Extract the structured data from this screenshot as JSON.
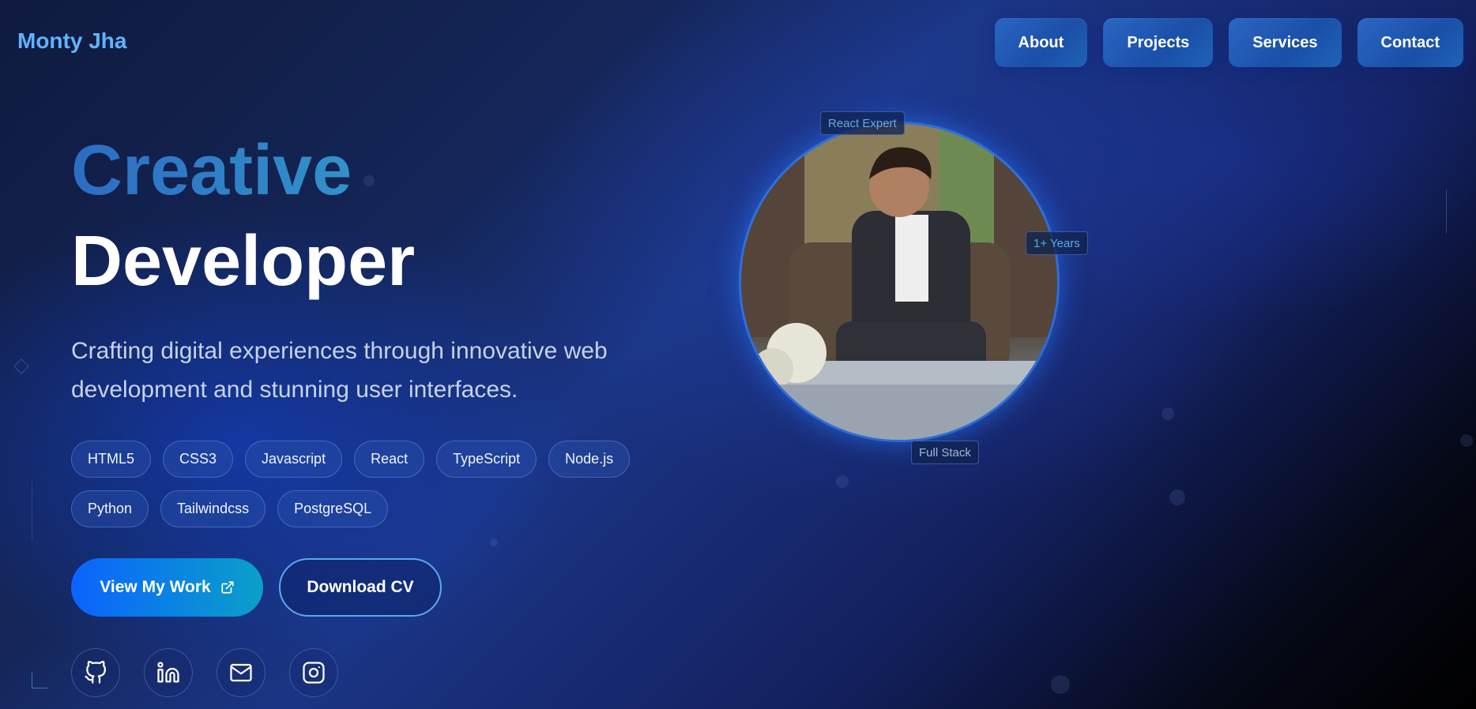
{
  "brand": "Monty Jha",
  "nav": [
    {
      "label": "About"
    },
    {
      "label": "Projects"
    },
    {
      "label": "Services"
    },
    {
      "label": "Contact"
    }
  ],
  "hero": {
    "line1": "Creative",
    "line2": "Developer",
    "subtitle": "Crafting digital experiences through innovative web development and stunning user interfaces."
  },
  "skills": [
    "HTML5",
    "CSS3",
    "Javascript",
    "React",
    "TypeScript",
    "Node.js",
    "Python",
    "Tailwindcss",
    "PostgreSQL"
  ],
  "buttons": {
    "view_work": "View My Work",
    "download_cv": "Download CV"
  },
  "socials": [
    {
      "name": "github-icon"
    },
    {
      "name": "linkedin-icon"
    },
    {
      "name": "mail-icon"
    },
    {
      "name": "instagram-icon"
    }
  ],
  "badges": {
    "react": "React Expert",
    "years": "1+ Years",
    "stack": "Full Stack"
  },
  "colors": {
    "accent": "#5fb4ff",
    "primary_gradient_start": "#0b63ff",
    "primary_gradient_end": "#0aa0c8",
    "nav_button": "#2a66c4"
  }
}
